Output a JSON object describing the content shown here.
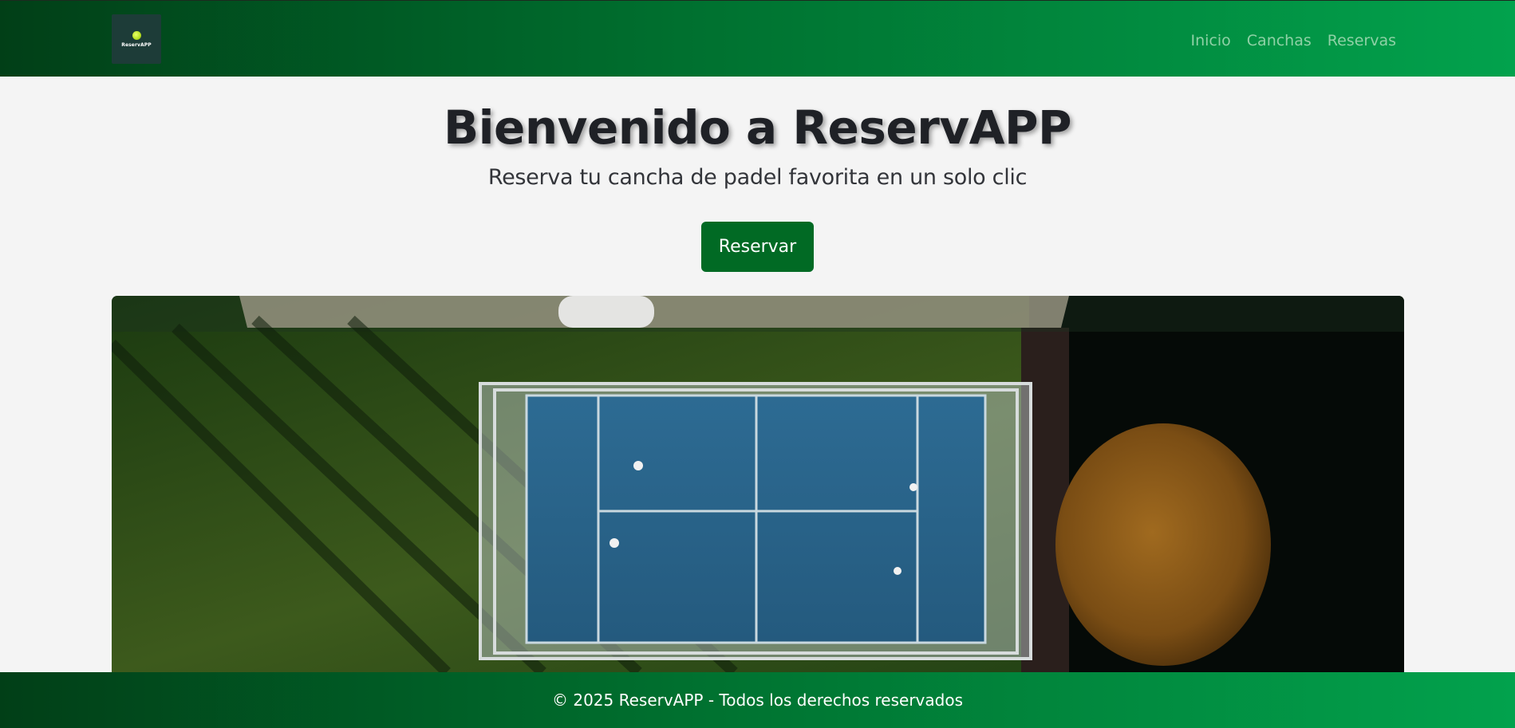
{
  "brand": {
    "logo_text": "ReservAPP"
  },
  "nav": {
    "items": [
      {
        "label": "Inicio"
      },
      {
        "label": "Canchas"
      },
      {
        "label": "Reservas"
      }
    ]
  },
  "hero": {
    "title": "Bienvenido a ReservAPP",
    "subtitle": "Reserva tu cancha de padel favorita en un solo clic",
    "cta_label": "Reservar"
  },
  "footer": {
    "text": "© 2025 ReservAPP - Todos los derechos reservados"
  },
  "colors": {
    "header_gradient_start": "#013f17",
    "header_gradient_end": "#02a24d",
    "button": "#016a24",
    "nav_link": "#8fd1a6",
    "background": "#f4f4f4"
  }
}
